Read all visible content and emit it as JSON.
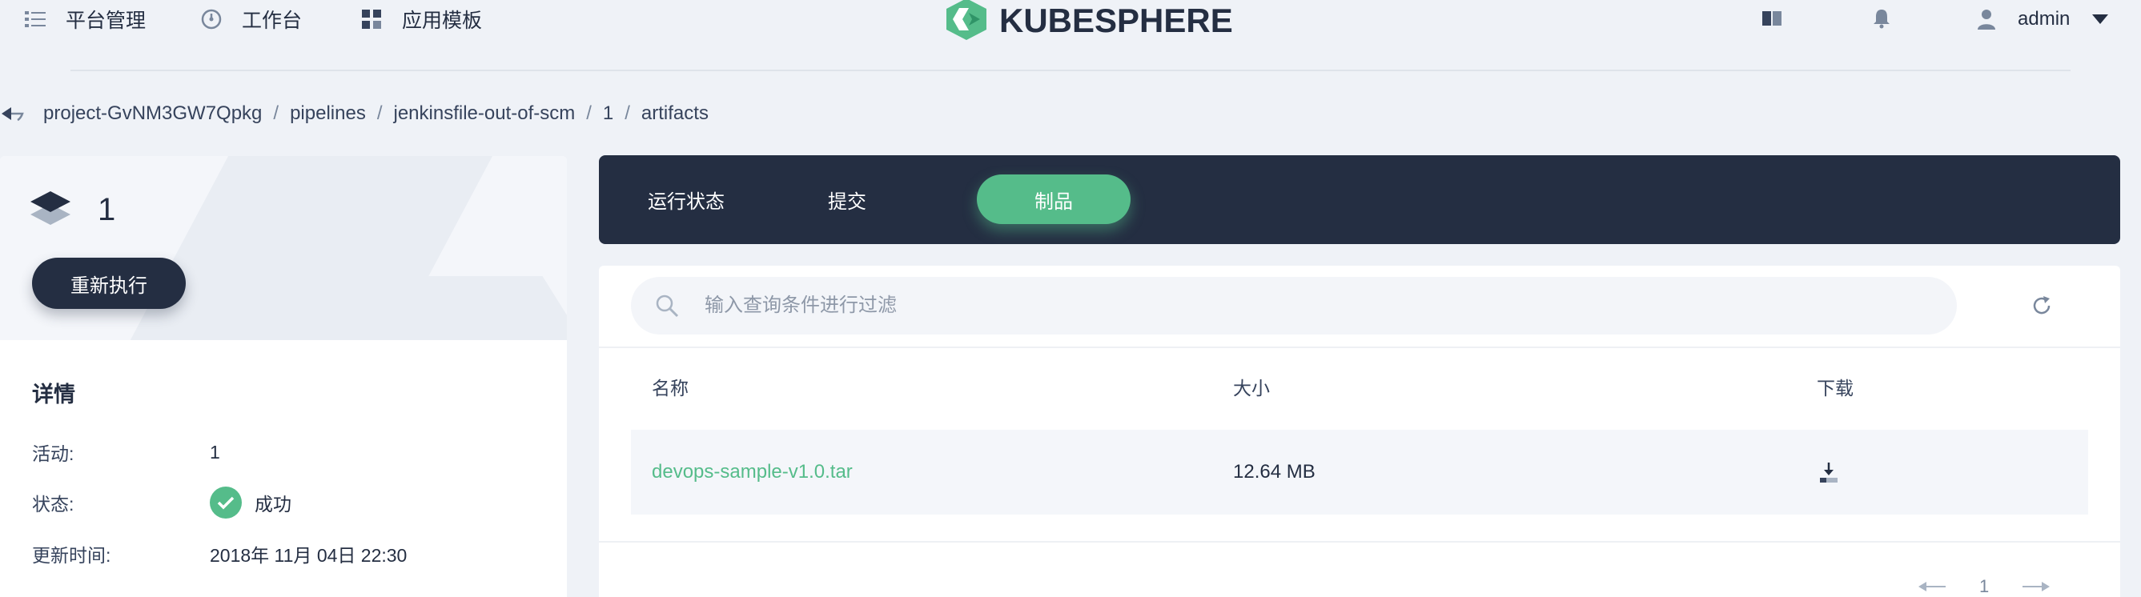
{
  "nav": {
    "items": [
      {
        "label": "平台管理",
        "icon": "list-icon"
      },
      {
        "label": "工作台",
        "icon": "dashboard-icon"
      },
      {
        "label": "应用模板",
        "icon": "grid-icon"
      }
    ],
    "logo_text": "KUBESPHERE",
    "user": "admin"
  },
  "breadcrumb": [
    "project-GvNM3GW7Qpkg",
    "pipelines",
    "jenkinsfile-out-of-scm",
    "1",
    "artifacts"
  ],
  "run": {
    "id": "1",
    "rerun_label": "重新执行"
  },
  "details": {
    "title": "详情",
    "rows": [
      {
        "key": "活动:",
        "value": "1"
      },
      {
        "key": "状态:",
        "value": "成功"
      },
      {
        "key": "更新时间:",
        "value": "2018年 11月 04日 22:30"
      }
    ]
  },
  "tabs": [
    {
      "label": "运行状态",
      "active": false
    },
    {
      "label": "提交",
      "active": false
    },
    {
      "label": "制品",
      "active": true
    }
  ],
  "search": {
    "placeholder": "输入查询条件进行过滤",
    "value": ""
  },
  "table": {
    "headers": [
      "名称",
      "大小",
      "下载"
    ],
    "rows": [
      {
        "name": "devops-sample-v1.0.tar",
        "size": "12.64 MB"
      }
    ]
  },
  "pagination": {
    "page": "1"
  },
  "colors": {
    "accent": "#55bc8a",
    "dark": "#242e42",
    "background": "#eff2f7"
  }
}
